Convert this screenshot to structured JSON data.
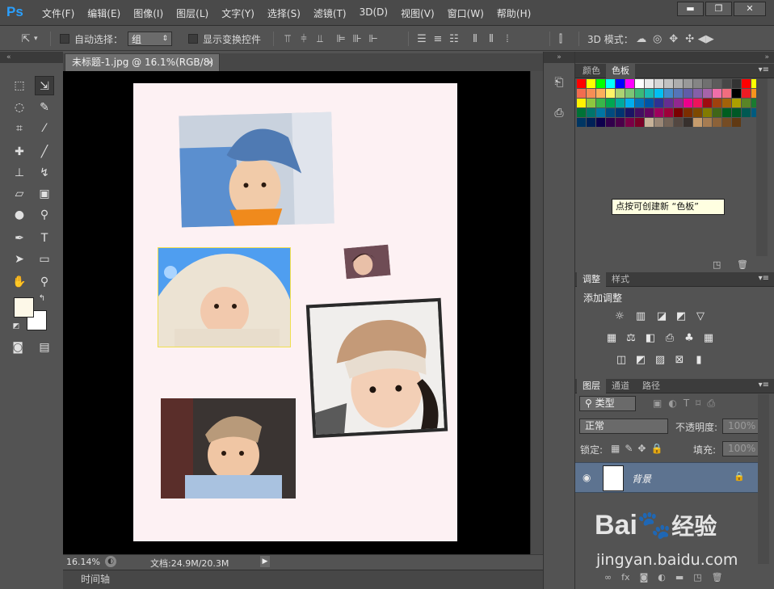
{
  "menubar": {
    "logo": "Ps",
    "items": [
      "文件(F)",
      "编辑(E)",
      "图像(I)",
      "图层(L)",
      "文字(Y)",
      "选择(S)",
      "滤镜(T)",
      "3D(D)",
      "视图(V)",
      "窗口(W)",
      "帮助(H)"
    ],
    "window_controls": [
      "▬",
      "❐",
      "✕"
    ]
  },
  "options": {
    "auto_select_label": "自动选择：",
    "auto_select_value": "组",
    "show_transform_label": "显示变换控件",
    "mode_3d_label": "3D 模式："
  },
  "document": {
    "tab_title": "未标题-1.jpg @ 16.1%(RGB/8)",
    "tab_close": "×",
    "zoom": "16.14%",
    "doc_size": "文档:24.9M/20.3M"
  },
  "timeline": {
    "label": "时间轴"
  },
  "swatches_panel": {
    "tabs": [
      "颜色",
      "色板"
    ],
    "tooltip": "点按可创建新 “色板”",
    "colors": [
      "#ff0000",
      "#ffff00",
      "#00ff00",
      "#00ffff",
      "#0000ff",
      "#ff00ff",
      "#ffffff",
      "#ebebeb",
      "#d6d6d6",
      "#c2c2c2",
      "#adadad",
      "#999999",
      "#858585",
      "#707070",
      "#5c5c5c",
      "#474747",
      "#333333",
      "#ff0000",
      "#ffff00",
      "#f26c4f",
      "#f68e55",
      "#fbaf5c",
      "#fff467",
      "#acd372",
      "#7cc576",
      "#3bb878",
      "#1abbb4",
      "#00bff3",
      "#438ccb",
      "#5574b9",
      "#605ca8",
      "#855fa8",
      "#a763a9",
      "#ef6ea8",
      "#f16d7e",
      "#000000",
      "#ed1c24",
      "#f7941d",
      "#fff200",
      "#8dc63f",
      "#39b54a",
      "#00a651",
      "#00a99d",
      "#00aeef",
      "#0072bc",
      "#0054a6",
      "#2e3192",
      "#662d91",
      "#92278f",
      "#ec008c",
      "#ed145b",
      "#9e0b0f",
      "#a0410d",
      "#a36209",
      "#aba000",
      "#598527",
      "#1a7b30",
      "#007236",
      "#00746b",
      "#0076a3",
      "#004b80",
      "#003471",
      "#1b1464",
      "#440e62",
      "#630460",
      "#9e005d",
      "#9e0039",
      "#790000",
      "#7b2e00",
      "#7d4900",
      "#827b00",
      "#406618",
      "#005e20",
      "#005826",
      "#005952",
      "#005b7f",
      "#003663",
      "#002157",
      "#0d004c",
      "#32004b",
      "#4b0049",
      "#7b0046",
      "#7a0026",
      "#c7b299",
      "#998675",
      "#736357",
      "#534741",
      "#37302d",
      "#c69c6d",
      "#a67c52",
      "#8c6239",
      "#754c24",
      "#603913"
    ]
  },
  "adjustments_panel": {
    "tabs": [
      "调整",
      "样式"
    ],
    "title": "添加调整"
  },
  "layers_panel": {
    "tabs": [
      "图层",
      "通道",
      "路径"
    ],
    "filter_label": "类型",
    "blend_mode": "正常",
    "opacity_label": "不透明度:",
    "opacity_value": "100%",
    "lock_label": "锁定:",
    "fill_label": "填充:",
    "fill_value": "100%",
    "layer_name": "背景"
  },
  "watermark": {
    "brand": "Bai",
    "brand_suffix": "经验",
    "url": "jingyan.baidu.com"
  }
}
